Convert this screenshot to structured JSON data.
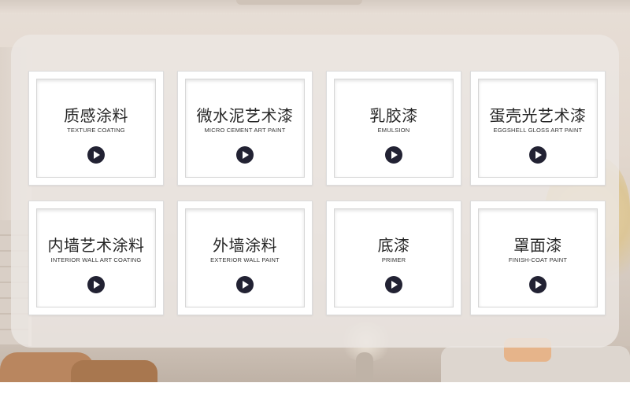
{
  "cards": [
    {
      "title": "质感涂料",
      "subtitle": "TEXTURE COATING",
      "icon": "play-icon"
    },
    {
      "title": "微水泥艺术漆",
      "subtitle": "MICRO CEMENT ART PAINT",
      "icon": "play-icon"
    },
    {
      "title": "乳胶漆",
      "subtitle": "EMULSION",
      "icon": "play-icon"
    },
    {
      "title": "蛋壳光艺术漆",
      "subtitle": "EGGSHELL GLOSS ART PAINT",
      "icon": "play-icon"
    },
    {
      "title": "内墙艺术涂料",
      "subtitle": "INTERIOR WALL ART COATING",
      "icon": "play-icon"
    },
    {
      "title": "外墙涂料",
      "subtitle": "EXTERIOR WALL PAINT",
      "icon": "play-icon"
    },
    {
      "title": "底漆",
      "subtitle": "PRIMER",
      "icon": "play-icon"
    },
    {
      "title": "罩面漆",
      "subtitle": "FINISH-COAT PAINT",
      "icon": "play-icon"
    }
  ],
  "colors": {
    "play_button": "#222233",
    "card_bg": "#ffffff",
    "panel_bg": "#ece7e3"
  }
}
